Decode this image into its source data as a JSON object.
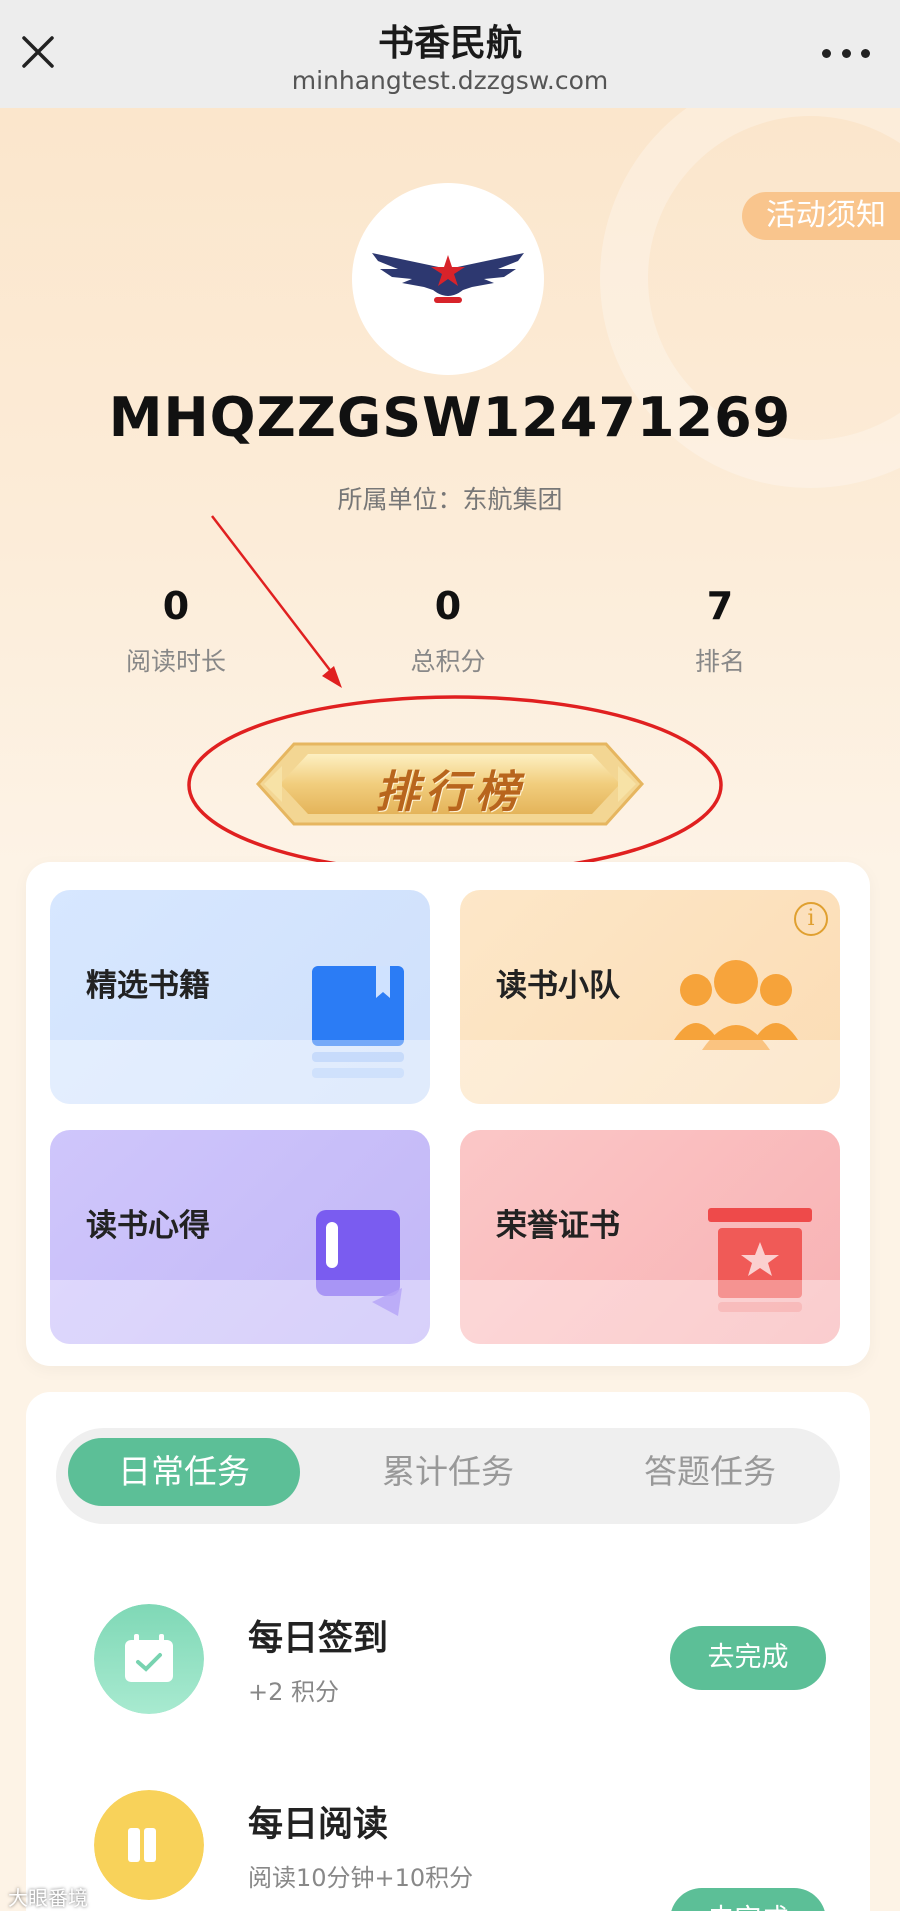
{
  "nav": {
    "title": "书香民航",
    "url": "minhangtest.dzzgsw.com"
  },
  "profile": {
    "notice_label": "活动须知",
    "user_id": "MHQZZGSW12471269",
    "org_text": "所属单位：东航集团"
  },
  "stats": [
    {
      "value": "0",
      "label": "阅读时长"
    },
    {
      "value": "0",
      "label": "总积分"
    },
    {
      "value": "7",
      "label": "排名"
    }
  ],
  "leaderboard_label": "排行榜",
  "features": [
    {
      "label": "精选书籍",
      "icon": "book-icon"
    },
    {
      "label": "读书小队",
      "icon": "team-icon"
    },
    {
      "label": "读书心得",
      "icon": "notes-icon"
    },
    {
      "label": "荣誉证书",
      "icon": "certificate-icon"
    }
  ],
  "task_tabs": [
    "日常任务",
    "累计任务",
    "答题任务"
  ],
  "active_tab": "日常任务",
  "tasks": [
    {
      "name": "每日签到",
      "desc": "+2 积分",
      "button": "去完成",
      "icon": "calendar-check-icon"
    },
    {
      "name": "每日阅读",
      "desc": "阅读10分钟+10积分",
      "button": "去完成",
      "icon": "reading-icon"
    }
  ],
  "watermark": "大眼番境",
  "colors": {
    "accent": "#5cbf97",
    "annotation": "#e02020",
    "notice_badge": "#f9c58d"
  }
}
